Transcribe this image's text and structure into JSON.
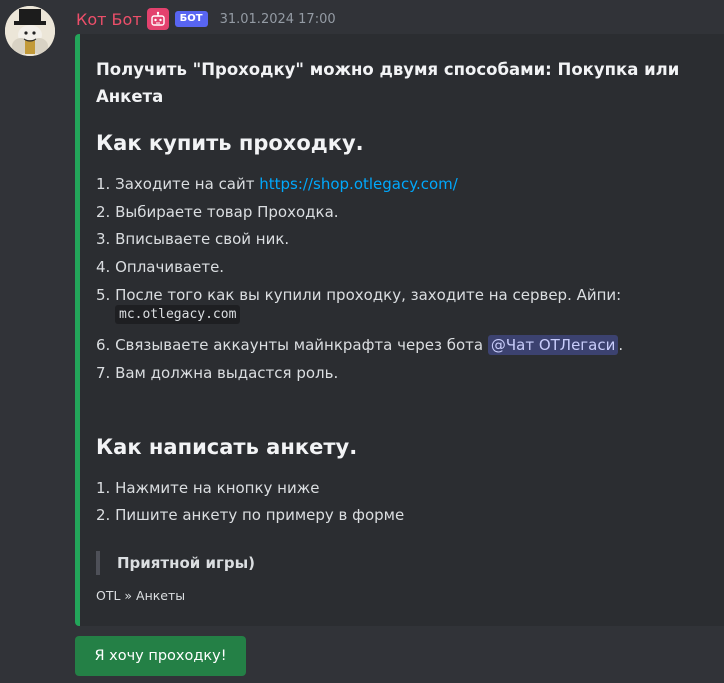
{
  "message": {
    "author": "Кот Бот",
    "bot_tag": "БОТ",
    "timestamp": "31.01.2024 17:00"
  },
  "embed": {
    "accent_color": "#23a55a",
    "intro": "Получить \"Проходку\" можно двумя способами: Покупка или Анкета",
    "buy": {
      "title": "Как купить проходку.",
      "step1_prefix": "1. Заходите на сайт ",
      "step1_link": "https://shop.otlegacy.com/",
      "step2": "2. Выбираете товар Проходка.",
      "step3": "3. Вписываете свой ник.",
      "step4": "4. Оплачиваете.",
      "step5": "5. После того как вы купили проходку, заходите на сервер. Айпи:",
      "step5_code": "mc.otlegacy.com",
      "step6_prefix": "6. Связываете аккаунты майнкрафта через бота ",
      "step6_mention": "@Чат OTЛегаси",
      "step6_suffix": ".",
      "step7": "7. Вам должна выдастся роль."
    },
    "form": {
      "title": "Как написать анкету.",
      "step1": "1. Нажмите на кнопку ниже",
      "step2": "2. Пишите анкету по примеру в форме"
    },
    "quote": "Приятной игры)",
    "footer": "OTL » Анкеты"
  },
  "button": {
    "label": "Я хочу проходку!"
  }
}
